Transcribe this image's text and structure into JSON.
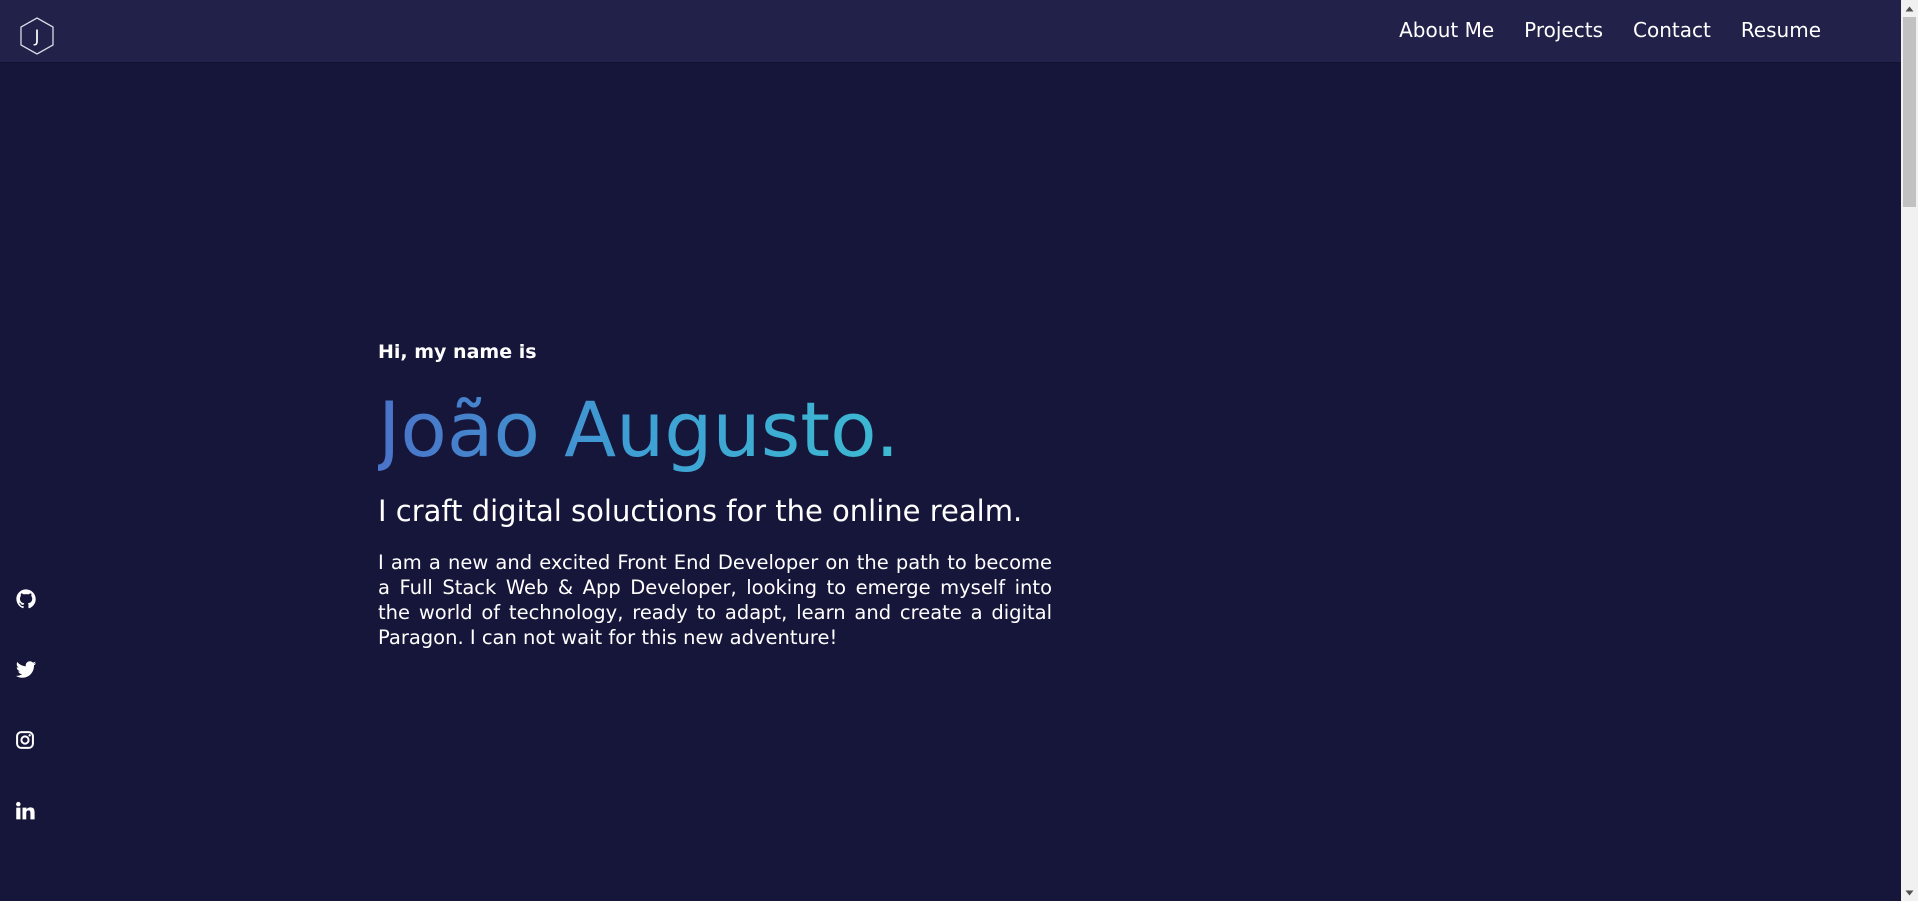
{
  "header": {
    "logo_letter": "J",
    "nav": [
      {
        "label": "About Me"
      },
      {
        "label": "Projects"
      },
      {
        "label": "Contact"
      },
      {
        "label": "Resume"
      }
    ]
  },
  "hero": {
    "greeting": "Hi, my name is",
    "name": "João Augusto.",
    "tagline": "I craft digital soluctions for the online realm.",
    "bio": "I am a new and excited Front End Developer on the path to become a Full Stack Web & App Developer, looking to emerge myself into the world of technology, ready to adapt, learn and create a digital Paragon. I can not wait for this new adventure!"
  },
  "social": [
    {
      "icon": "github-icon"
    },
    {
      "icon": "twitter-icon"
    },
    {
      "icon": "instagram-icon"
    },
    {
      "icon": "linkedin-icon"
    }
  ],
  "colors": {
    "background": "#16163a",
    "header": "#212149",
    "name_gradient_start": "#4a73c9",
    "name_gradient_end": "#3cc9d0",
    "text": "#ffffff"
  }
}
